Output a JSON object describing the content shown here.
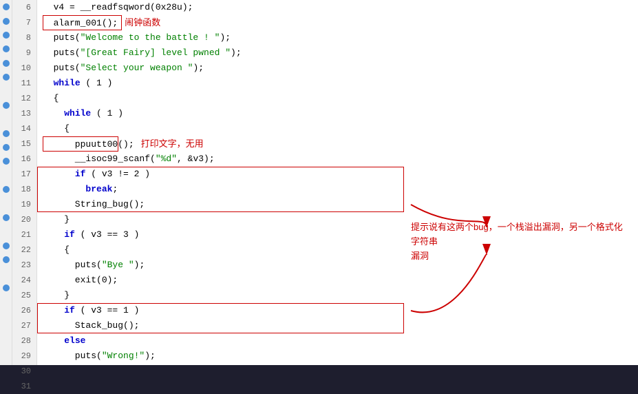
{
  "lines": [
    {
      "num": 6,
      "dot": true,
      "indent": 0,
      "content": "  v4 = __readfsqword(0x28u);"
    },
    {
      "num": 7,
      "dot": true,
      "indent": 0,
      "content": "  alarm_001();",
      "boxed": true,
      "annotation": "闹钟函数"
    },
    {
      "num": 8,
      "dot": true,
      "indent": 0,
      "content": "  puts(\"Welcome to the battle ! \");"
    },
    {
      "num": 9,
      "dot": true,
      "indent": 0,
      "content": "  puts(\"[Great Fairy] level pwned \");"
    },
    {
      "num": 10,
      "dot": true,
      "indent": 0,
      "content": "  puts(\"Select your weapon \");"
    },
    {
      "num": 11,
      "dot": true,
      "indent": 0,
      "content": "  while ( 1 )"
    },
    {
      "num": 12,
      "dot": false,
      "indent": 0,
      "content": "  {"
    },
    {
      "num": 13,
      "dot": true,
      "indent": 0,
      "content": "    while ( 1 )"
    },
    {
      "num": 14,
      "dot": false,
      "indent": 0,
      "content": "    {"
    },
    {
      "num": 15,
      "dot": true,
      "indent": 0,
      "content": "      ppuutt00();",
      "boxed": true,
      "annotation": "打印文字，无用"
    },
    {
      "num": 16,
      "dot": true,
      "indent": 0,
      "content": "      __isoc99_scanf(\"%d\", &v3);"
    },
    {
      "num": 17,
      "dot": true,
      "indent": 0,
      "content": "      if ( v3 != 2 )",
      "boxed": true
    },
    {
      "num": 18,
      "dot": false,
      "indent": 0,
      "content": "        break;",
      "boxed": true
    },
    {
      "num": 19,
      "dot": true,
      "indent": 0,
      "content": "      String_bug();",
      "boxed": true
    },
    {
      "num": 20,
      "dot": false,
      "indent": 0,
      "content": "    }"
    },
    {
      "num": 21,
      "dot": true,
      "indent": 0,
      "content": "    if ( v3 == 3 )"
    },
    {
      "num": 22,
      "dot": false,
      "indent": 0,
      "content": "    {"
    },
    {
      "num": 23,
      "dot": true,
      "indent": 0,
      "content": "      puts(\"Bye \");"
    },
    {
      "num": 24,
      "dot": true,
      "indent": 0,
      "content": "      exit(0);"
    },
    {
      "num": 25,
      "dot": false,
      "indent": 0,
      "content": "    }"
    },
    {
      "num": 26,
      "dot": true,
      "indent": 0,
      "content": "    if ( v3 == 1 )",
      "boxed": true
    },
    {
      "num": 27,
      "dot": false,
      "indent": 0,
      "content": "      Stack_bug();",
      "boxed": true
    },
    {
      "num": 28,
      "dot": false,
      "indent": 0,
      "content": "    else"
    },
    {
      "num": 29,
      "dot": false,
      "indent": 0,
      "content": "      puts(\"Wrong!\");"
    },
    {
      "num": 30,
      "dot": false,
      "indent": 0,
      "content": "  }"
    },
    {
      "num": 31,
      "dot": false,
      "indent": 0,
      "content": "}"
    }
  ],
  "annotation_mid": "提示说有这两个bug，一个栈溢出漏洞，另一个格式化字符串",
  "annotation_mid2": "漏洞"
}
